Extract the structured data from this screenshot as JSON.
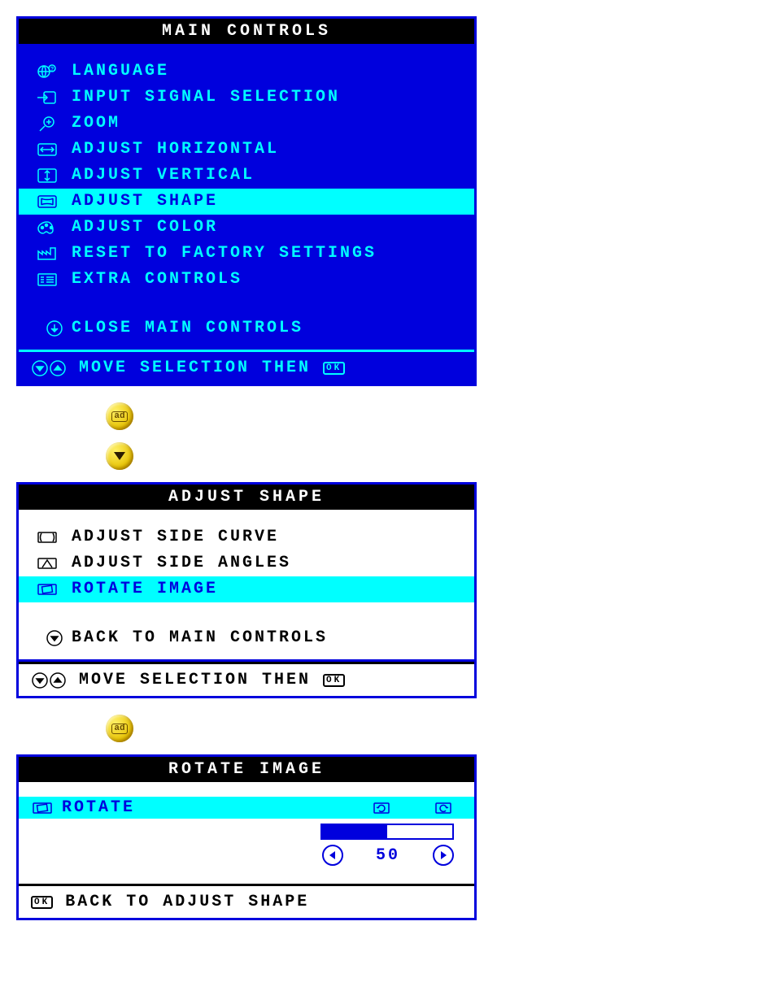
{
  "main": {
    "title": "MAIN CONTROLS",
    "items": [
      {
        "icon": "language-icon",
        "label": "LANGUAGE",
        "selected": false
      },
      {
        "icon": "input-icon",
        "label": "INPUT SIGNAL SELECTION",
        "selected": false
      },
      {
        "icon": "zoom-icon",
        "label": "ZOOM",
        "selected": false
      },
      {
        "icon": "horizontal-icon",
        "label": "ADJUST HORIZONTAL",
        "selected": false
      },
      {
        "icon": "vertical-icon",
        "label": "ADJUST VERTICAL",
        "selected": false
      },
      {
        "icon": "shape-icon",
        "label": "ADJUST SHAPE",
        "selected": true
      },
      {
        "icon": "color-icon",
        "label": "ADJUST COLOR",
        "selected": false
      },
      {
        "icon": "factory-icon",
        "label": "RESET TO FACTORY SETTINGS",
        "selected": false
      },
      {
        "icon": "extra-icon",
        "label": "EXTRA CONTROLS",
        "selected": false
      }
    ],
    "close": "CLOSE MAIN CONTROLS",
    "footer": "MOVE SELECTION THEN"
  },
  "shape": {
    "title": "ADJUST SHAPE",
    "items": [
      {
        "icon": "side-curve-icon",
        "label": "ADJUST SIDE CURVE",
        "selected": false
      },
      {
        "icon": "side-angles-icon",
        "label": "ADJUST SIDE ANGLES",
        "selected": false
      },
      {
        "icon": "rotate-image-icon",
        "label": "ROTATE IMAGE",
        "selected": true
      }
    ],
    "back": "BACK TO MAIN CONTROLS",
    "footer": "MOVE SELECTION THEN"
  },
  "rotate": {
    "title": "ROTATE IMAGE",
    "label": "ROTATE",
    "value": "50",
    "back": "BACK TO ADJUST SHAPE"
  }
}
